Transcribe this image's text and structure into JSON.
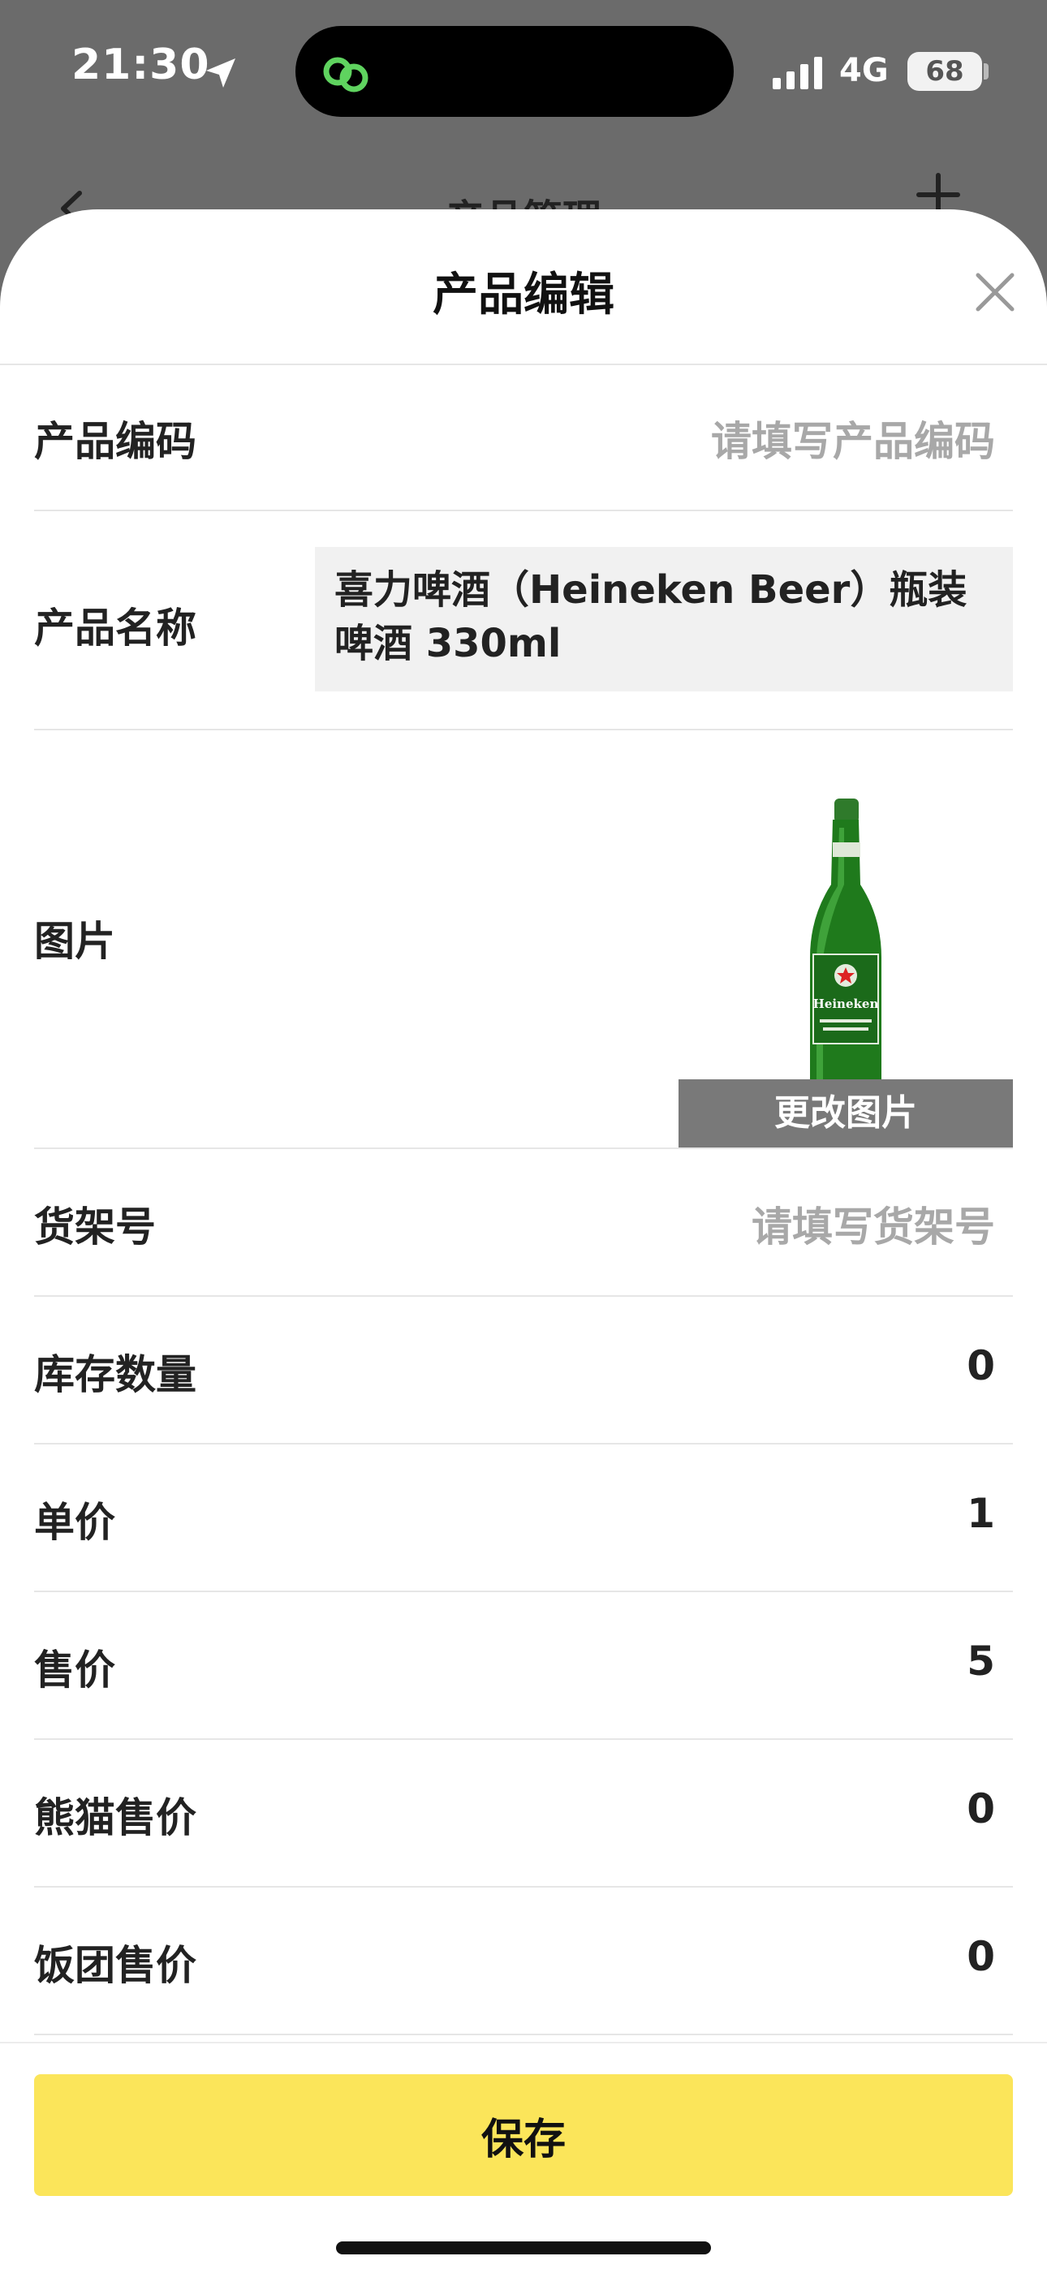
{
  "status_bar": {
    "time": "21:30",
    "network": "4G",
    "battery": "68"
  },
  "background_header": {
    "title": "产品管理"
  },
  "sheet": {
    "title": "产品编辑"
  },
  "form": {
    "product_code": {
      "label": "产品编码",
      "placeholder": "请填写产品编码"
    },
    "product_name": {
      "label": "产品名称",
      "value": "喜力啤酒（Heineken Beer）瓶装啤酒 330ml"
    },
    "image": {
      "label": "图片",
      "change_button": "更改图片",
      "bottle_text": "Heineken"
    },
    "shelf_no": {
      "label": "货架号",
      "placeholder": "请填写货架号"
    },
    "stock_qty": {
      "label": "库存数量",
      "value": "0"
    },
    "unit_price": {
      "label": "单价",
      "value": "1"
    },
    "sale_price": {
      "label": "售价",
      "value": "5"
    },
    "panda_price": {
      "label": "熊猫售价",
      "value": "0"
    },
    "fantuan_price": {
      "label": "饭团售价",
      "value": "0"
    }
  },
  "actions": {
    "save_label": "保存"
  },
  "colors": {
    "accent": "#fbe55a",
    "overlay": "#6b6b6b",
    "placeholder": "#a8a8a8"
  }
}
